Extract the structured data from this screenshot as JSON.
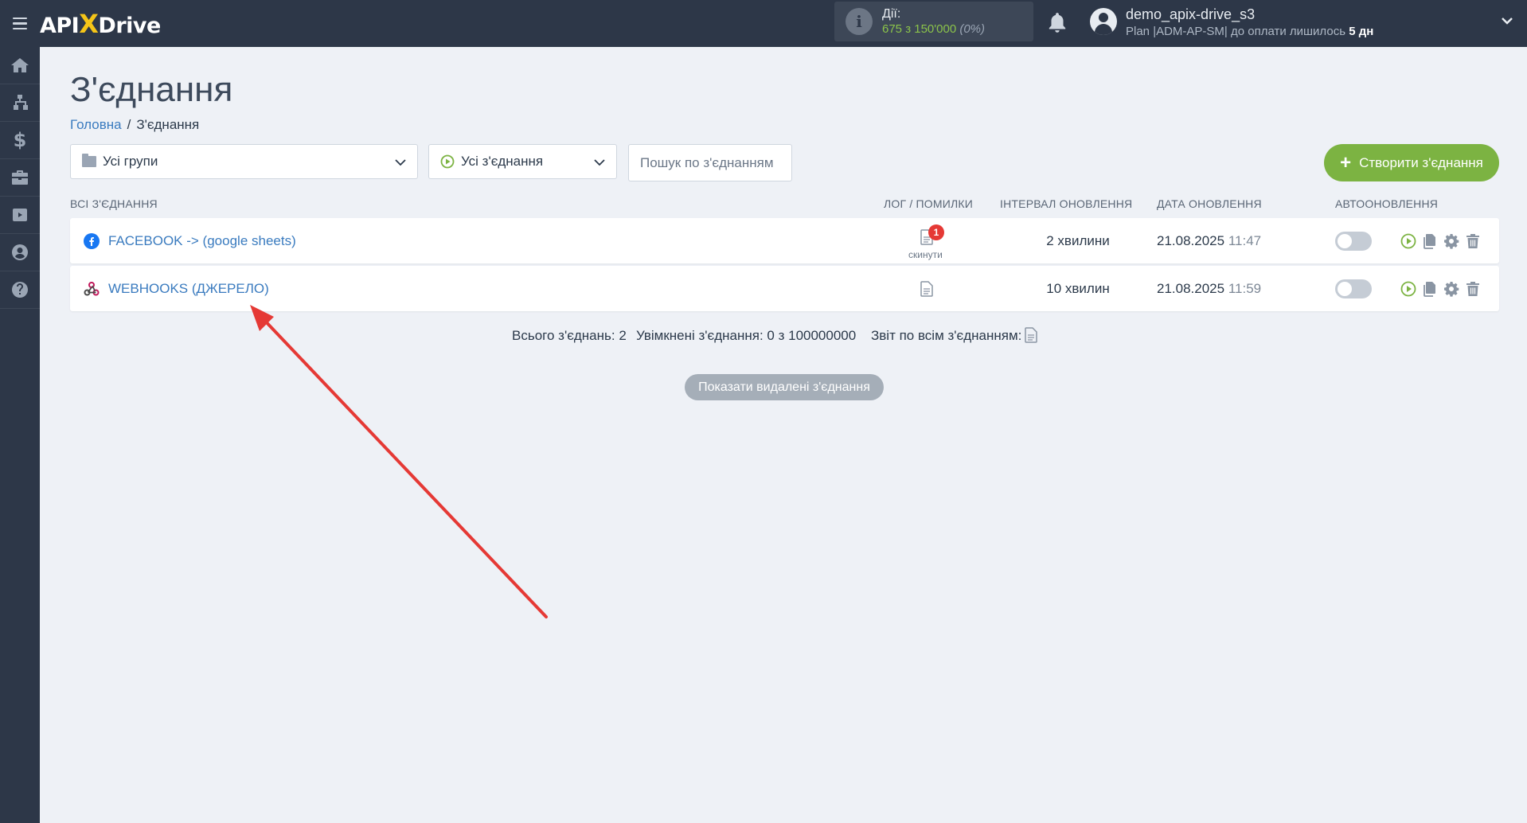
{
  "app": {
    "logo_left": "API",
    "logo_x": "X",
    "logo_right": "Drive"
  },
  "header": {
    "actions_title": "Дії:",
    "actions_value": "675 з 150'000",
    "actions_pct": "(0%)",
    "user_name": "demo_apix-drive_s3",
    "plan_text": "Plan |ADM-AP-SM| до оплати лишилось ",
    "plan_days": "5 дн"
  },
  "sidebar": {
    "items": [
      {
        "icon": "home-icon"
      },
      {
        "icon": "sitemap-icon"
      },
      {
        "icon": "dollar-icon",
        "glyph": "$"
      },
      {
        "icon": "briefcase-icon"
      },
      {
        "icon": "youtube-icon"
      },
      {
        "icon": "user-circle-icon"
      },
      {
        "icon": "help-icon"
      }
    ]
  },
  "page": {
    "title": "З'єднання",
    "breadcrumb_home": "Головна",
    "breadcrumb_sep": "/",
    "breadcrumb_current": "З'єднання"
  },
  "filters": {
    "groups_value": "Усі групи",
    "connections_value": "Усі з'єднання",
    "search_placeholder": "Пошук по з'єднанням",
    "create_label": "Створити з'єднання",
    "create_plus": "+"
  },
  "table": {
    "headers": {
      "all": "ВСІ З'ЄДНАННЯ",
      "log": "ЛОГ / ПОМИЛКИ",
      "interval": "ІНТЕРВАЛ ОНОВЛЕННЯ",
      "date": "ДАТА ОНОВЛЕННЯ",
      "auto": "АВТООНОВЛЕННЯ"
    },
    "rows": [
      {
        "name": "FACEBOOK -> (google sheets)",
        "icon": "facebook-icon",
        "errors": "1",
        "reset": "скинути",
        "interval": "2 хвилини",
        "date": "21.08.2025",
        "time": "11:47",
        "auto": false
      },
      {
        "name": "WEBHOOKS (ДЖЕРЕЛО)",
        "icon": "webhook-icon",
        "interval": "10 хвилин",
        "date": "21.08.2025",
        "time": "11:59",
        "auto": false
      }
    ]
  },
  "summary": {
    "total": "Всього з'єднань: 2",
    "enabled": "Увімкнені з'єднання: 0 з 100000000",
    "report": "Звіт по всім з'єднанням:"
  },
  "show_deleted_label": "Показати видалені з'єднання",
  "colors": {
    "accent": "#7cb342",
    "link": "#3a7bbf",
    "dark": "#2d3748",
    "arrow": "#e53935",
    "badge": "#e53935"
  }
}
